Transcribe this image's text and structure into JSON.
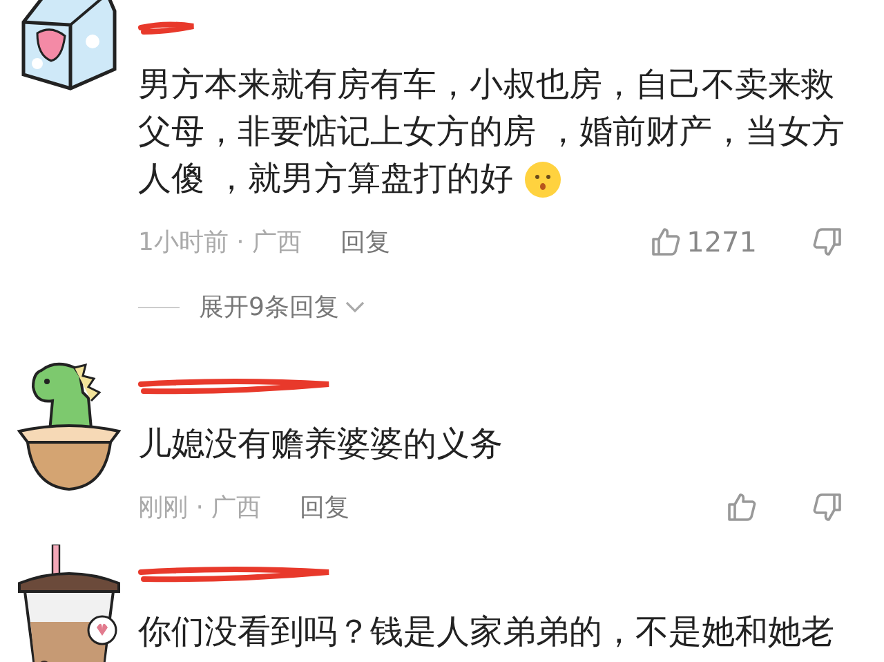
{
  "comments": [
    {
      "kind": "carton",
      "text": "男方本来就有房有车，小叔也房，自己不卖来救父母，非要惦记上女方的房 ，婚前财产，当女方人傻 ，就男方算盘打的好",
      "emoji": true,
      "time": "1小时前 · 广西",
      "reply": "回复",
      "likes": "1271",
      "expand": "展开9条回复"
    },
    {
      "kind": "dino",
      "text": "儿媳没有赡养婆婆的义务",
      "emoji": false,
      "time": "刚刚 · 广西",
      "reply": "回复"
    },
    {
      "kind": "tea",
      "text": "你们没看到吗？钱是人家弟弟的，不是她和她老",
      "emoji": false
    }
  ]
}
